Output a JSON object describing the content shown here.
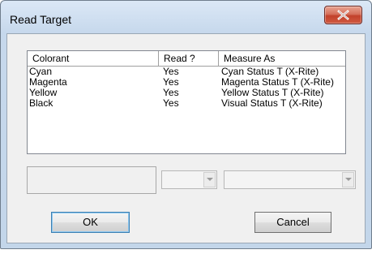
{
  "window": {
    "title": "Read Target",
    "close_icon": "close-icon"
  },
  "list": {
    "columns": [
      "Colorant",
      "Read ?",
      "Measure As"
    ],
    "rows": [
      {
        "colorant": "Cyan",
        "read": "Yes",
        "measure_as": "Cyan Status T (X-Rite)"
      },
      {
        "colorant": "Magenta",
        "read": "Yes",
        "measure_as": "Magenta Status T (X-Rite)"
      },
      {
        "colorant": "Yellow",
        "read": "Yes",
        "measure_as": "Yellow Status T (X-Rite)"
      },
      {
        "colorant": "Black",
        "read": "Yes",
        "measure_as": "Visual Status T (X-Rite)"
      }
    ]
  },
  "editors": {
    "colorant_value": "",
    "read_value": "",
    "measure_value": "",
    "arrow_icon": "chevron-down-icon"
  },
  "buttons": {
    "ok_label": "OK",
    "cancel_label": "Cancel"
  },
  "colors": {
    "title_bar": "#c6d8ec",
    "close_button": "#c2412b",
    "client_bg": "#f0f0f0"
  }
}
